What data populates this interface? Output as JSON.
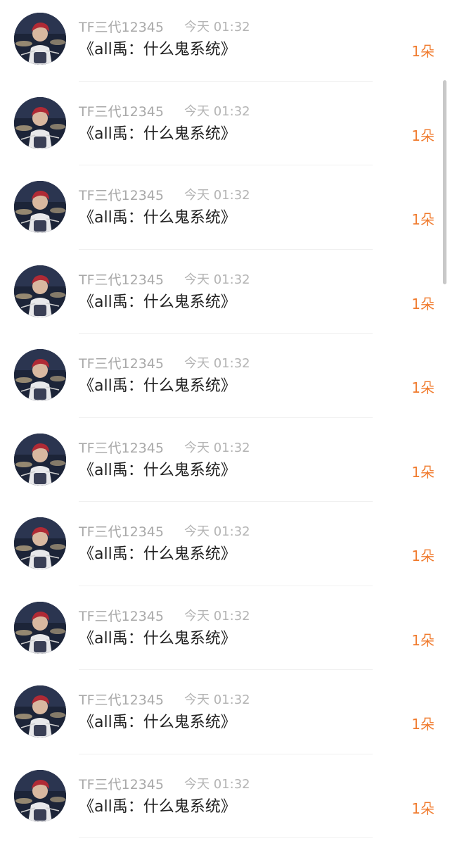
{
  "items": [
    {
      "name": "TF三代12345",
      "time": "今天 01:32",
      "title": "《all禹：什么鬼系统》",
      "count": "1朵"
    },
    {
      "name": "TF三代12345",
      "time": "今天 01:32",
      "title": "《all禹：什么鬼系统》",
      "count": "1朵"
    },
    {
      "name": "TF三代12345",
      "time": "今天 01:32",
      "title": "《all禹：什么鬼系统》",
      "count": "1朵"
    },
    {
      "name": "TF三代12345",
      "time": "今天 01:32",
      "title": "《all禹：什么鬼系统》",
      "count": "1朵"
    },
    {
      "name": "TF三代12345",
      "time": "今天 01:32",
      "title": "《all禹：什么鬼系统》",
      "count": "1朵"
    },
    {
      "name": "TF三代12345",
      "time": "今天 01:32",
      "title": "《all禹：什么鬼系统》",
      "count": "1朵"
    },
    {
      "name": "TF三代12345",
      "time": "今天 01:32",
      "title": "《all禹：什么鬼系统》",
      "count": "1朵"
    },
    {
      "name": "TF三代12345",
      "time": "今天 01:32",
      "title": "《all禹：什么鬼系统》",
      "count": "1朵"
    },
    {
      "name": "TF三代12345",
      "time": "今天 01:32",
      "title": "《all禹：什么鬼系统》",
      "count": "1朵"
    },
    {
      "name": "TF三代12345",
      "time": "今天 01:32",
      "title": "《all禹：什么鬼系统》",
      "count": "1朵"
    }
  ],
  "colors": {
    "name": "#a9a9a9",
    "time": "#b4b4b4",
    "title": "#222222",
    "count": "#f07a2c"
  },
  "avatar_icon": "avatar-drummer-photo"
}
